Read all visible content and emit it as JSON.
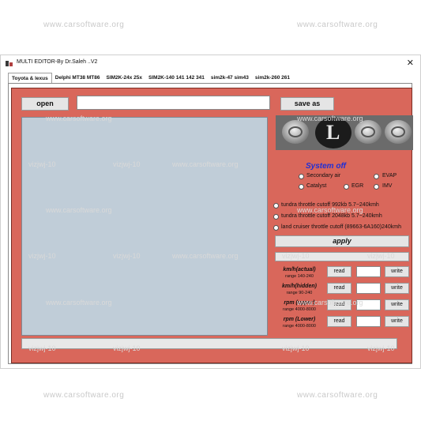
{
  "watermarks": {
    "top_left": "www.carsoftware.org",
    "top_right": "www.carsoftware.org",
    "mid_center": "www.carsoftware.org",
    "mid_lower": "www.carsoftware.org",
    "bottom_left": "www.carsoftware.org",
    "bottom_right": "www.carsoftware.org",
    "overlay": "www.carsoftware.org",
    "tag": "vizjwj-10"
  },
  "window": {
    "title": "MULTI EDITOR-By Dr.Saleh ..V2",
    "close_glyph": "✕"
  },
  "tabs": [
    {
      "label": "Toyota & lexus",
      "active": true
    },
    {
      "label": "Delphi MT38 MT86"
    },
    {
      "label": "SIM2K-24x 25x"
    },
    {
      "label": "SIM2K-140 141 142 341"
    },
    {
      "label": "sim2k-47 sim43"
    },
    {
      "label": "sim2k-260 261"
    }
  ],
  "toolbar": {
    "open_label": "open",
    "save_label": "save as",
    "file_path": ""
  },
  "system": {
    "status": "System off",
    "options": [
      {
        "label": "Secondary air"
      },
      {
        "label": "EVAP"
      },
      {
        "label": "Catalyst"
      },
      {
        "label": "EGR"
      },
      {
        "label": "IMV"
      }
    ]
  },
  "throttle_options": [
    {
      "label": "tundra throttle cutoff 992kb 5.7~240kmh"
    },
    {
      "label": "tundra throttle cutoff 2048kb 5.7~240kmh"
    },
    {
      "label": "land cruiser throttle cutoff (89663-6A160)240kmh"
    }
  ],
  "apply_label": "apply",
  "params": [
    {
      "label": "km/h(actual)",
      "range": "range 140-240",
      "read": "read",
      "write": "write",
      "value": ""
    },
    {
      "label": "km/h(hidden)",
      "range": "range 90-240",
      "read": "read",
      "write": "write",
      "value": ""
    },
    {
      "label": "rpm (upper)",
      "range": "range 4000-8000",
      "read": "read",
      "write": "write",
      "value": ""
    },
    {
      "label": "rpm (Lower)",
      "range": "range 4000-8000",
      "read": "read",
      "write": "write",
      "value": ""
    }
  ],
  "colors": {
    "panel": "#d9675b",
    "work_area": "#c0cdd8",
    "status_text": "#1f2fd6"
  }
}
